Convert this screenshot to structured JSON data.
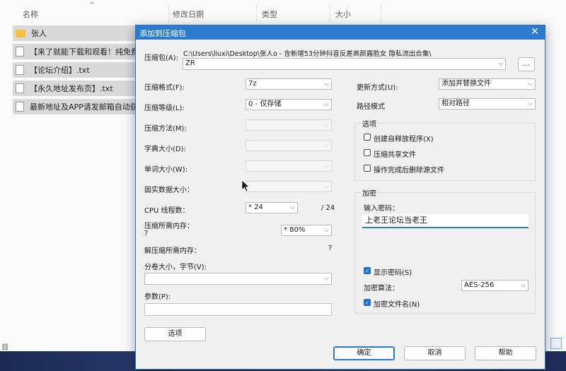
{
  "explorer": {
    "columns": [
      "名称",
      "修改日期",
      "类型",
      "大小"
    ],
    "files": [
      {
        "name": "张人",
        "type": "folder"
      },
      {
        "name": "【来了就能下载和观看！纯免费！",
        "type": "doc"
      },
      {
        "name": "【论坛介绍】.txt",
        "type": "doc"
      },
      {
        "name": "【永久地址发布页】.txt",
        "type": "doc"
      },
      {
        "name": "最新地址及APP请发邮箱自动获取",
        "type": "doc"
      }
    ],
    "status": "目"
  },
  "dialog": {
    "title": "添加到压缩包",
    "archive_label": "压缩包(A):",
    "archive_path": "C:\\Users\\liuxi\\Desktop\\张人o - 含新增53分钟抖音反差高颜露脸女 隐私流出合集\\",
    "archive_name": "ZR",
    "browse_label": "...",
    "format_label": "压缩格式(F):",
    "format_value": "7z",
    "level_label": "压缩等级(L):",
    "level_value": "0 - 仅存储",
    "method_label": "压缩方法(M):",
    "dict_label": "字典大小(D):",
    "word_label": "单词大小(W):",
    "solid_label": "固实数据大小：",
    "cpu_label": "CPU 线程数：",
    "cpu_value": "* 24",
    "cpu_total": "/ 24",
    "mem_comp_label": "压缩所需内存：",
    "mem_comp_value": "?",
    "mem_pct_value": "* 80%",
    "mem_decomp_label": "解压缩所需内存：",
    "mem_decomp_value": "?",
    "volume_label": "分卷大小，字节(V):",
    "params_label": "参数(P):",
    "options_button": "选项",
    "update_label": "更新方式(U):",
    "update_value": "添加并替换文件",
    "path_label": "路径模式",
    "path_value": "相对路径",
    "options_group": "选项",
    "opt_sfx": "创建自释放程序(X)",
    "opt_shared": "压缩共享文件",
    "opt_delete": "操作完成后删除源文件",
    "encrypt_group": "加密",
    "password_label": "输入密码：",
    "password_value": "上老王论坛当老王",
    "show_password": "显示密码(S)",
    "enc_method_label": "加密算法：",
    "enc_method_value": "AES-256",
    "encrypt_names": "加密文件名(N)",
    "ok": "确定",
    "cancel": "取消",
    "help": "帮助"
  },
  "colors": {
    "accent": "#2b7ad0",
    "checked": "#1f6fd1",
    "taskbar": "#2c3f78"
  }
}
